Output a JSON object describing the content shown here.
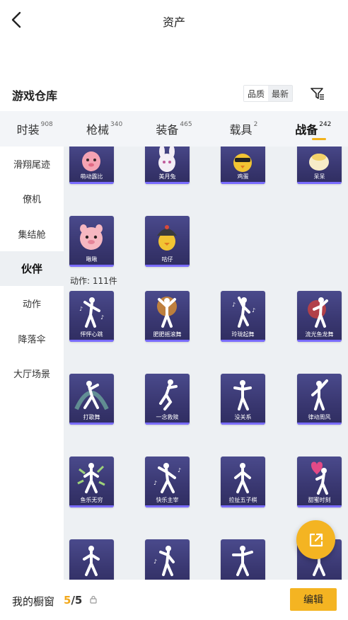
{
  "header": {
    "title": "资产"
  },
  "warehouse": {
    "title": "游戏仓库",
    "sort": {
      "quality": "品质",
      "latest": "最新"
    }
  },
  "tabs": [
    {
      "label": "时装",
      "count": "908",
      "active": false
    },
    {
      "label": "枪械",
      "count": "340",
      "active": false
    },
    {
      "label": "装备",
      "count": "465",
      "active": false
    },
    {
      "label": "载具",
      "count": "2",
      "active": false
    },
    {
      "label": "战备",
      "count": "242",
      "active": true
    }
  ],
  "sidebar": {
    "items": [
      {
        "label": "滑翔尾迹",
        "active": false
      },
      {
        "label": "僚机",
        "active": false
      },
      {
        "label": "集结舱",
        "active": false
      },
      {
        "label": "伙伴",
        "active": true
      },
      {
        "label": "动作",
        "active": false
      },
      {
        "label": "降落伞",
        "active": false
      },
      {
        "label": "大厅场景",
        "active": false
      }
    ]
  },
  "partners": {
    "items": [
      "萌动露比",
      "美月兔",
      "鸡蛋",
      "呆呆",
      "啾啾",
      "咕仔"
    ]
  },
  "actions": {
    "label": "动作: 111件",
    "items": [
      "怦怦心跳",
      "肥肥摇滚舞",
      "玲珑起舞",
      "流光鱼龙舞",
      "打歌舞",
      "一念救赎",
      "没关系",
      "律动周风",
      "鱼乐无穷",
      "快乐主宰",
      "拉扯五子棋",
      "甜蜜时刻",
      "",
      "",
      "",
      ""
    ]
  },
  "bottom": {
    "label": "我的橱窗",
    "count_current": "5",
    "count_total": "/5",
    "edit": "编辑"
  },
  "colors": {
    "accent": "#f4b422",
    "card_bg": "#3a3872",
    "card_border": "#7a6cff"
  }
}
